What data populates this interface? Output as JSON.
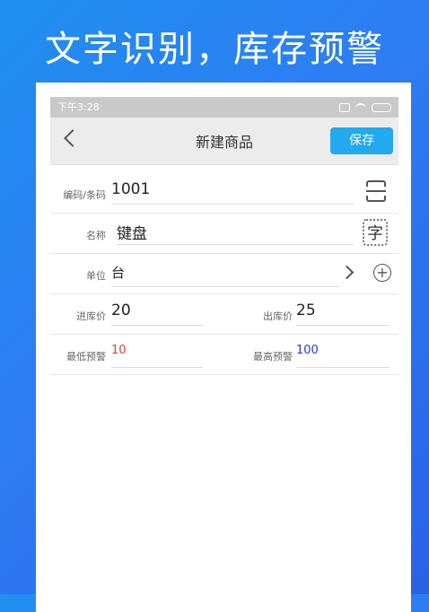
{
  "banner": {
    "text": "文字识别，库存预警"
  },
  "statusbar": {
    "time": "下午3:28"
  },
  "navbar": {
    "title": "新建商品",
    "save_label": "保存"
  },
  "form": {
    "code": {
      "label": "编码/条码",
      "value": "1001"
    },
    "name": {
      "label": "名称",
      "value": "键盘"
    },
    "unit": {
      "label": "单位",
      "value": "台"
    },
    "buy_price": {
      "label": "进库价",
      "value": "20"
    },
    "sell_price": {
      "label": "出库价",
      "value": "25"
    },
    "min_alert": {
      "label": "最低预警",
      "value": "10",
      "color": "#e53935"
    },
    "max_alert": {
      "label": "最高预警",
      "value": "100",
      "color": "#1e3bd6"
    },
    "char_icon_text": "字"
  }
}
